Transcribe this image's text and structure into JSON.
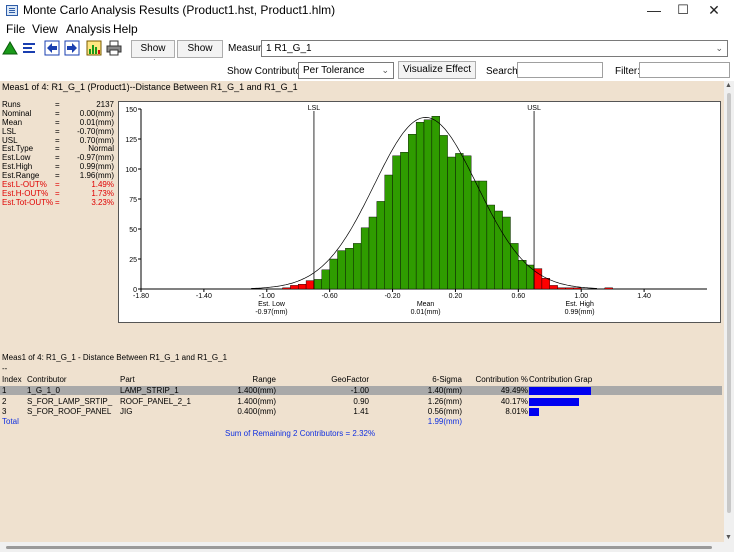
{
  "window": {
    "title": "Monte Carlo Analysis Results (Product1.hst, Product1.hlm)",
    "minimize": "—",
    "maximize": "☐",
    "close": "✕"
  },
  "menu": [
    "File",
    "View",
    "Analysis",
    "Help"
  ],
  "toolbar": {
    "show_min": "Show Min",
    "show_max": "Show Max",
    "measure_label": "Measure:",
    "measure_value": "1 R1_G_1"
  },
  "filterbar": {
    "contributors_label": "Show Contributors:",
    "contributors_value": "Per Tolerance",
    "visualize": "Visualize Effect",
    "search_label": "Search:",
    "filter_label": "Filter:"
  },
  "panel": {
    "header": "Meas1 of 4: R1_G_1 (Product1)--Distance Between R1_G_1 and R1_G_1"
  },
  "stats": [
    {
      "k": "Runs",
      "v": "2137",
      "red": false
    },
    {
      "k": "Nominal",
      "v": "0.00(mm)",
      "red": false
    },
    {
      "k": "Mean",
      "v": "0.01(mm)",
      "red": false
    },
    {
      "k": "LSL",
      "v": "-0.70(mm)",
      "red": false
    },
    {
      "k": "USL",
      "v": "0.70(mm)",
      "red": false
    },
    {
      "k": "Est.Type",
      "v": "Normal",
      "red": false
    },
    {
      "k": "Est.Low",
      "v": "-0.97(mm)",
      "red": false
    },
    {
      "k": "Est.High",
      "v": "0.99(mm)",
      "red": false
    },
    {
      "k": "Est.Range",
      "v": "1.96(mm)",
      "red": false
    },
    {
      "k": "Est.L-OUT%",
      "v": "1.49%",
      "red": true
    },
    {
      "k": "Est.H-OUT%",
      "v": "1.73%",
      "red": true
    },
    {
      "k": "Est.Tot-OUT%",
      "v": "3.23%",
      "red": true
    }
  ],
  "chart_data": {
    "type": "bar",
    "xlim": [
      -1.8,
      1.8
    ],
    "ylim": [
      0,
      150
    ],
    "xticks": [
      -1.8,
      -1.4,
      -1.0,
      -0.6,
      -0.2,
      0.2,
      0.6,
      1.0,
      1.4
    ],
    "xtick_labels": [
      "-1.80",
      "-1.40",
      "-1.00",
      "-0.60",
      "-0.20",
      "0.20",
      "0.60",
      "1.00",
      "1.40"
    ],
    "yticks": [
      0,
      25,
      50,
      75,
      100,
      125,
      150
    ],
    "bin_width": 0.05,
    "bins_start": [
      -0.9,
      -0.85,
      -0.8,
      -0.75,
      -0.7,
      -0.65,
      -0.6,
      -0.55,
      -0.5,
      -0.45,
      -0.4,
      -0.35,
      -0.3,
      -0.25,
      -0.2,
      -0.15,
      -0.1,
      -0.05,
      0.0,
      0.05,
      0.1,
      0.15,
      0.2,
      0.25,
      0.3,
      0.35,
      0.4,
      0.45,
      0.5,
      0.55,
      0.6,
      0.65,
      0.7,
      0.75,
      0.8,
      0.85,
      0.9,
      0.95,
      1.15
    ],
    "counts": [
      1,
      3,
      4,
      7,
      8,
      16,
      25,
      32,
      34,
      38,
      51,
      60,
      73,
      95,
      111,
      114,
      129,
      139,
      141,
      144,
      128,
      110,
      113,
      111,
      90,
      90,
      70,
      65,
      60,
      38,
      24,
      20,
      17,
      9,
      3,
      1,
      1,
      1,
      1
    ],
    "colors": {
      "in": "#2f9c00",
      "out": "#ff0000"
    },
    "lsl": -0.7,
    "usl": 0.7,
    "lsl_label": "LSL",
    "usl_label": "USL",
    "normal_curve": {
      "mean": 0.01,
      "sigma": 0.327,
      "peak": 143
    },
    "bottom_labels": [
      {
        "at": -0.97,
        "name": "Est. Low",
        "value": "-0.97(mm)"
      },
      {
        "at": 0.01,
        "name": "Mean",
        "value": "0.01(mm)"
      },
      {
        "at": 0.99,
        "name": "Est. High",
        "value": "0.99(mm)"
      }
    ]
  },
  "contrib": {
    "title": "Meas1 of 4: R1_G_1 - Distance Between R1_G_1 and R1_G_1",
    "dash": "--",
    "headers": {
      "index": "Index",
      "contributor": "Contributor",
      "part": "Part",
      "range": "Range",
      "geofactor": "GeoFactor",
      "sigma": "6-Sigma",
      "pct": "Contribution %",
      "graph": "Contribution Grap"
    },
    "rows": [
      {
        "index": "1",
        "contributor": "1_G_1_0",
        "part": "LAMP_STRIP_1",
        "range": "1.400(mm)",
        "geofactor": "-1.00",
        "sigma": "1.40(mm)",
        "pct": "49.49%",
        "bar": 0.4949
      },
      {
        "index": "2",
        "contributor": "S_FOR_LAMP_SRTIP_",
        "part": "ROOF_PANEL_2_1",
        "range": "1.400(mm)",
        "geofactor": "0.90",
        "sigma": "1.26(mm)",
        "pct": "40.17%",
        "bar": 0.4017
      },
      {
        "index": "3",
        "contributor": "S_FOR_ROOF_PANEL",
        "part": "JIG",
        "range": "0.400(mm)",
        "geofactor": "1.41",
        "sigma": "0.56(mm)",
        "pct": "8.01%",
        "bar": 0.0801
      }
    ],
    "total_label": "Total",
    "total_sigma": "1.99(mm)",
    "sum_note": "Sum of Remaining 2 Contributors = 2.32%"
  }
}
